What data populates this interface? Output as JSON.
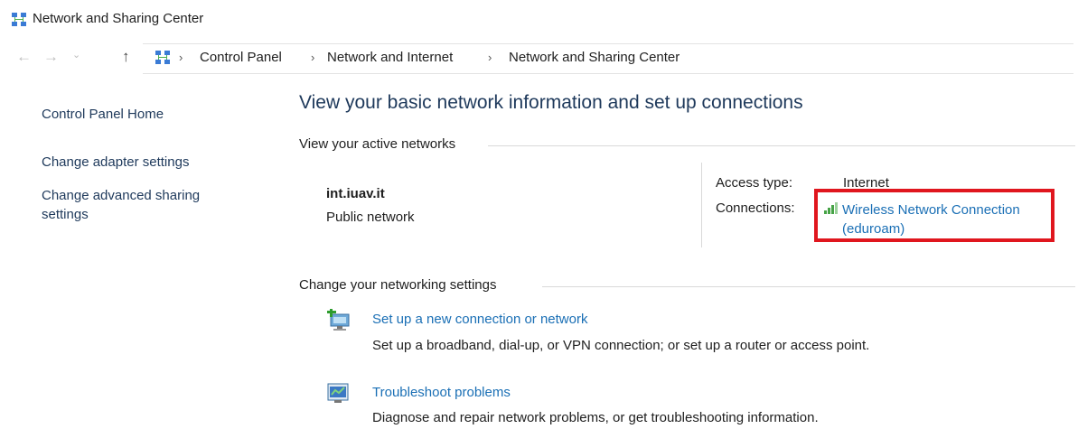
{
  "window": {
    "title": "Network and Sharing Center",
    "icon": "network-center-icon"
  },
  "address_bar": {
    "back": "back-arrow-icon",
    "forward": "forward-arrow-icon",
    "recent": "chevron-down-icon",
    "up": "up-arrow-icon",
    "breadcrumb": [
      "Control Panel",
      "Network and Internet",
      "Network and Sharing Center"
    ]
  },
  "sidebar": {
    "items": [
      {
        "label": "Control Panel Home"
      },
      {
        "label": "Change adapter settings"
      },
      {
        "label": "Change advanced sharing settings"
      }
    ]
  },
  "main": {
    "heading": "View your basic network information and set up connections",
    "active_networks_label": "View your active networks",
    "network": {
      "name": "int.iuav.it",
      "type": "Public network",
      "access_type_label": "Access type:",
      "access_type_value": "Internet",
      "connections_label": "Connections:",
      "connection_name": "Wireless Network Connection (eduroam)",
      "highlight_color": "#e0161e"
    },
    "change_settings_label": "Change your networking settings",
    "tasks": [
      {
        "title": "Set up a new connection or network",
        "description": "Set up a broadband, dial-up, or VPN connection; or set up a router or access point.",
        "icon": "new-connection-icon"
      },
      {
        "title": "Troubleshoot problems",
        "description": "Diagnose and repair network problems, or get troubleshooting information.",
        "icon": "troubleshoot-icon"
      }
    ]
  }
}
